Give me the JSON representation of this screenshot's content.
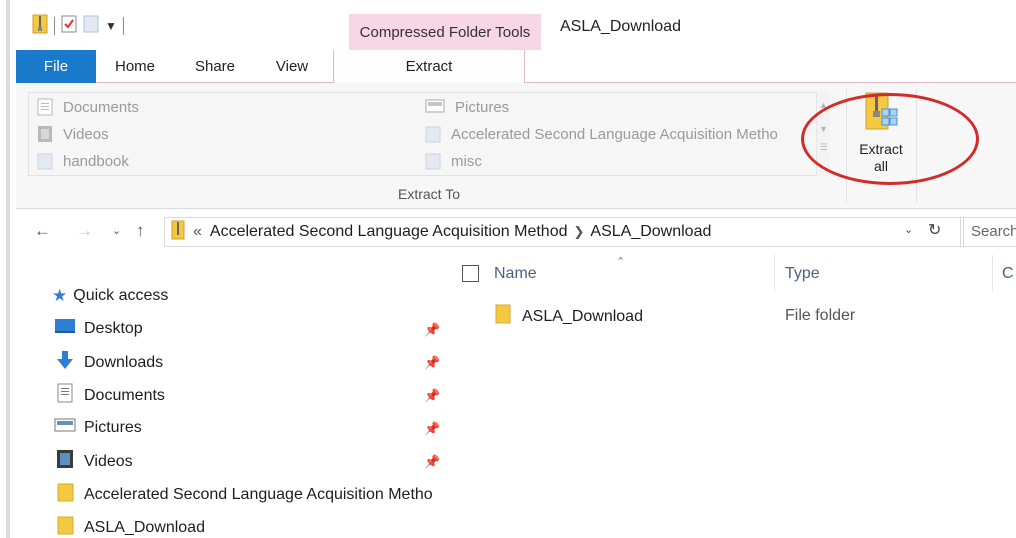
{
  "window": {
    "title": "ASLA_Download",
    "context_tab": "Compressed Folder Tools"
  },
  "ribbon_tabs": [
    "File",
    "Home",
    "Share",
    "View",
    "Extract"
  ],
  "extract_to": {
    "group_label": "Extract To",
    "left_items": [
      "Documents",
      "Videos",
      "handbook"
    ],
    "right_items": [
      "Pictures",
      "Accelerated Second Language Acquisition Metho",
      "misc"
    ]
  },
  "extract_all": {
    "line1": "Extract",
    "line2": "all"
  },
  "address": {
    "prefix": "«",
    "crumbs": [
      "Accelerated Second Language Acquisition Method",
      "ASLA_Download"
    ],
    "search_placeholder": "Search"
  },
  "nav_pane": {
    "quick_access": "Quick access",
    "items": [
      "Desktop",
      "Downloads",
      "Documents",
      "Pictures",
      "Videos",
      "Accelerated Second Language Acquisition Metho",
      "ASLA_Download"
    ]
  },
  "file_list": {
    "columns": [
      "Name",
      "Type",
      "C"
    ],
    "rows": [
      {
        "name": "ASLA_Download",
        "type": "File folder"
      }
    ]
  },
  "colors": {
    "file_tab": "#1979ca",
    "context_tab": "#f7d6e6",
    "highlight_circle": "#d32a2a",
    "folder": "#f5c842"
  }
}
